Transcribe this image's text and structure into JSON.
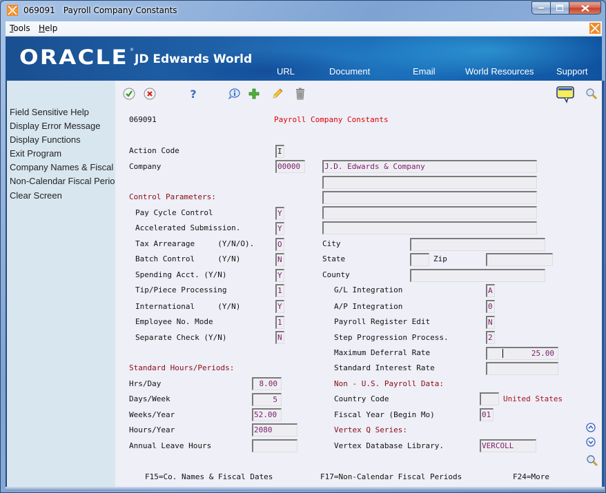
{
  "window": {
    "program_id": "069091",
    "title": "Payroll Company Constants",
    "icon": "jde-app-icon",
    "controls": [
      "minimize-icon",
      "maximize-icon",
      "close-icon"
    ]
  },
  "menubar": {
    "items": [
      {
        "label": "Tools",
        "accel": "T",
        "rest": "ools"
      },
      {
        "label": "Help",
        "accel": "H",
        "rest": "elp"
      }
    ]
  },
  "banner": {
    "brand": "ORACLE",
    "product": "JD Edwards World",
    "links": [
      "URL",
      "Document",
      "Email",
      "World Resources",
      "Support"
    ]
  },
  "sidebar": {
    "items": [
      "Field Sensitive Help",
      "Display Error Message",
      "Display Functions",
      "Exit Program",
      "Company Names & Fiscal Dates",
      "Non-Calendar Fiscal Periods",
      "Clear Screen"
    ]
  },
  "toolbar": {
    "icons": [
      "accept-icon",
      "cancel-icon",
      "help-icon",
      "info-icon",
      "add-icon",
      "edit-pencil-icon",
      "delete-trash-icon"
    ],
    "right_icons": [
      "message-bubble-icon",
      "search-icon"
    ]
  },
  "form": {
    "program_id": "069091",
    "title": "Payroll Company Constants",
    "action_code": {
      "label": "Action Code",
      "value": "I"
    },
    "company": {
      "label": "Company",
      "value": "00000",
      "name": "J.D. Edwards & Company",
      "address_lines": [
        "",
        "",
        "",
        ""
      ]
    },
    "control_parameters": {
      "heading": "Control Parameters:",
      "rows": [
        {
          "label": "Pay Cycle Control",
          "value": "Y"
        },
        {
          "label": "Accelerated Submission.",
          "value": "Y"
        },
        {
          "label": "Tax Arrearage     (Y/N/O).",
          "value": "O"
        },
        {
          "label": "Batch Control     (Y/N)",
          "value": "N"
        },
        {
          "label": "Spending Acct. (Y/N)",
          "value": "Y"
        },
        {
          "label": "Tip/Piece Processing",
          "value": "1"
        },
        {
          "label": "International     (Y/N)",
          "value": "Y"
        },
        {
          "label": "Employee No. Mode",
          "value": "1"
        },
        {
          "label": "Separate Check (Y/N)",
          "value": "N"
        }
      ]
    },
    "address": {
      "city": {
        "label": "City",
        "value": ""
      },
      "state": {
        "label": "State",
        "value": ""
      },
      "zip": {
        "label": "Zip",
        "value": ""
      },
      "county": {
        "label": "County",
        "value": ""
      }
    },
    "integration": [
      {
        "label": "G/L Integration",
        "value": "A"
      },
      {
        "label": "A/P Integration",
        "value": "0"
      },
      {
        "label": "Payroll Register Edit",
        "value": "N"
      },
      {
        "label": "Step Progression Process.",
        "value": "2"
      }
    ],
    "rates": {
      "max_deferral": {
        "label": "Maximum Deferral Rate",
        "value": "25.00"
      },
      "std_interest": {
        "label": "Standard Interest Rate",
        "value": ""
      }
    },
    "standard_hours": {
      "heading": "Standard Hours/Periods:",
      "hrs_day": {
        "label": "Hrs/Day",
        "value": "8.00"
      },
      "days_week": {
        "label": "Days/Week",
        "value": "5"
      },
      "weeks_year": {
        "label": "Weeks/Year",
        "value": "52.00"
      },
      "hours_year": {
        "label": "Hours/Year",
        "value": "2080"
      },
      "annual_leave": {
        "label": "Annual Leave Hours",
        "value": ""
      }
    },
    "non_us": {
      "heading": "Non - U.S. Payroll Data:",
      "country_code": {
        "label": "Country Code",
        "value": "",
        "description": "United States"
      },
      "fiscal_year": {
        "label": "Fiscal Year (Begin Mo)",
        "value": "01"
      }
    },
    "vertex": {
      "heading": "Vertex Q Series:",
      "library": {
        "label": "Vertex Database Library.",
        "value": "VERCOLL"
      }
    },
    "function_keys": [
      "F15=Co. Names & Fiscal Dates",
      "F17=Non-Calendar Fiscal Periods",
      "F24=More"
    ]
  },
  "side_nav": [
    "page-up-icon",
    "page-down-icon",
    "zoom-search-icon"
  ]
}
